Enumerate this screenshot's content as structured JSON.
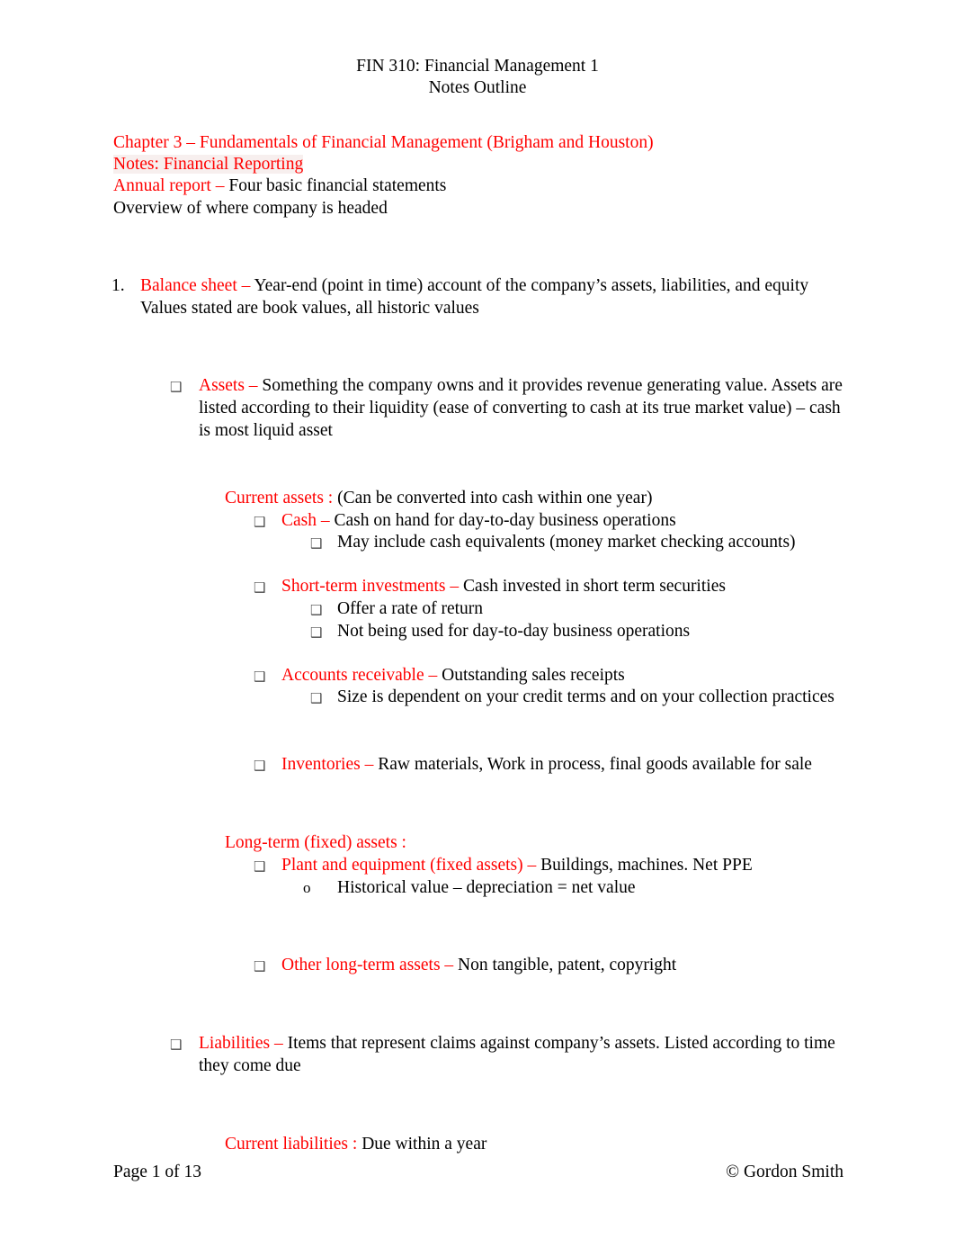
{
  "document": {
    "title_line1": "FIN 310: Financial Management 1",
    "title_line2": "Notes Outline"
  },
  "intro": {
    "chapter": "Chapter 3 – Fundamentals of Financial Management (Brigham and Houston)",
    "notes_heading": "Notes: Financial Reporting",
    "annual_report_term": "Annual report  – ",
    "annual_report_def": "Four basic financial statements",
    "overview": "Overview of where company is headed"
  },
  "outline": {
    "item1_marker": "1.",
    "item1_term": "Balance sheet  – ",
    "item1_def": "Year-end (point in time) account of the company’s assets, liabilities, and equity",
    "item1_cont": "Values stated are book values, all historic values",
    "assets": {
      "bullet": "❑",
      "term": "Assets – ",
      "def": "Something the company owns and it provides revenue generating value. Assets are listed according to their liquidity (ease of converting to cash at its true market value) – cash is most liquid asset"
    },
    "current_assets": {
      "heading_term": "Current assets : ",
      "heading_def": "(Can be converted into cash within one year)",
      "cash": {
        "bullet": "❑",
        "term": "Cash – ",
        "def": "Cash on hand for day-to-day business operations",
        "sub": [
          {
            "bullet": "❑",
            "text": "May include cash equivalents (money market checking accounts)"
          }
        ]
      },
      "short_term": {
        "bullet": "❑",
        "term": "Short-term investments    – ",
        "def": "Cash invested in short term securities",
        "sub": [
          {
            "bullet": "❑",
            "text": "Offer a rate of return"
          },
          {
            "bullet": "❑",
            "text": "Not being used for day-to-day business operations"
          }
        ]
      },
      "accounts_receivable": {
        "bullet": "❑",
        "term": "Accounts receivable – ",
        "def": "Outstanding sales receipts",
        "sub": [
          {
            "bullet": "❑",
            "text": "Size is dependent on your credit terms and on your collection practices"
          }
        ]
      },
      "inventories": {
        "bullet": "❑",
        "term": "Inventories – ",
        "def": "Raw materials, Work in process, final goods available for sale"
      }
    },
    "long_term_assets": {
      "heading": "Long-term (fixed) assets  :",
      "plant": {
        "bullet": "❑",
        "term": "Plant and equipment  (fixed assets) – ",
        "def": "Buildings, machines. Net PPE",
        "sub": [
          {
            "marker": "o",
            "text": "Historical value – depreciation = net value"
          }
        ]
      },
      "other": {
        "bullet": "❑",
        "term": "Other long-term assets  – ",
        "def": "Non tangible, patent, copyright"
      }
    },
    "liabilities": {
      "bullet": "❑",
      "term": "Liabilities – ",
      "def": "Items that represent claims against company’s assets. Listed according to time they come due",
      "current_liabilities_term": "Current liabilities : ",
      "current_liabilities_def": "Due within a year"
    }
  },
  "footer": {
    "page_label": "Page 1 of 13",
    "copyright": "© Gordon Smith"
  },
  "colors": {
    "accent_red": "#FF0000",
    "text_black": "#000000",
    "highlight": "#f7efee"
  }
}
